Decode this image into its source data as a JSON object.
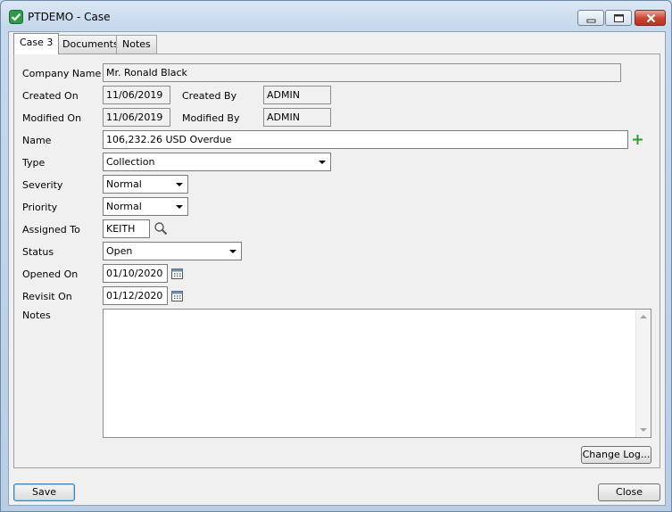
{
  "window": {
    "title": "PTDEMO - Case",
    "colors": {
      "add_icon": "#2e9c2e",
      "close_button": "#c9422f"
    }
  },
  "tabs": [
    {
      "label": "Case 3",
      "active": true
    },
    {
      "label": "Documents",
      "active": false
    },
    {
      "label": "Notes",
      "active": false
    }
  ],
  "form": {
    "company_name": {
      "label": "Company Name",
      "value": "Mr. Ronald Black"
    },
    "created_on": {
      "label": "Created On",
      "value": "11/06/2019"
    },
    "created_by": {
      "label": "Created By",
      "value": "ADMIN"
    },
    "modified_on": {
      "label": "Modified On",
      "value": "11/06/2019"
    },
    "modified_by": {
      "label": "Modified By",
      "value": "ADMIN"
    },
    "name": {
      "label": "Name",
      "value": "106,232.26 USD Overdue"
    },
    "type": {
      "label": "Type",
      "value": "Collection"
    },
    "severity": {
      "label": "Severity",
      "value": "Normal"
    },
    "priority": {
      "label": "Priority",
      "value": "Normal"
    },
    "assigned_to": {
      "label": "Assigned To",
      "value": "KEITH"
    },
    "status": {
      "label": "Status",
      "value": "Open"
    },
    "opened_on": {
      "label": "Opened On",
      "value": "01/10/2020"
    },
    "revisit_on": {
      "label": "Revisit On",
      "value": "01/12/2020"
    },
    "notes": {
      "label": "Notes",
      "value": ""
    }
  },
  "buttons": {
    "change_log": "Change Log...",
    "save": "Save",
    "close": "Close"
  },
  "icons": {
    "app": "case-app-icon",
    "add": "plus-icon",
    "lookup": "magnifier-icon",
    "calendar": "calendar-icon"
  }
}
